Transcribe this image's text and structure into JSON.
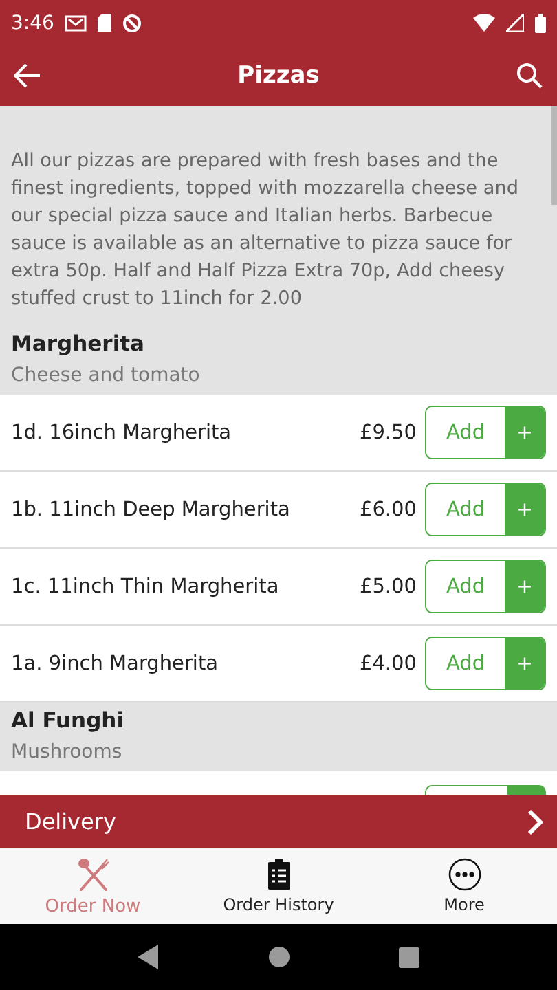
{
  "status_bar": {
    "time": "3:46"
  },
  "app_bar": {
    "title": "Pizzas"
  },
  "intro": "All our pizzas are prepared with fresh bases and the finest ingredients, topped with mozzarella cheese and our special pizza sauce and Italian herbs. Barbecue sauce is available as an alternative to pizza sauce for extra 50p. Half and Half Pizza Extra 70p, Add cheesy stuffed crust to 11inch for 2.00",
  "categories": [
    {
      "name": "Margherita",
      "description": "Cheese and tomato",
      "items": [
        {
          "name": "1d. 16inch Margherita",
          "price": "£9.50",
          "button": "Add",
          "plus": "+"
        },
        {
          "name": "1b. 11inch Deep Margherita",
          "price": "£6.00",
          "button": "Add",
          "plus": "+"
        },
        {
          "name": "1c. 11inch Thin Margherita",
          "price": "£5.00",
          "button": "Add",
          "plus": "+"
        },
        {
          "name": "1a. 9inch Margherita",
          "price": "£4.00",
          "button": "Add",
          "plus": "+"
        }
      ]
    },
    {
      "name": "Al Funghi",
      "description": "Mushrooms"
    }
  ],
  "delivery_bar": {
    "label": "Delivery"
  },
  "bottom_nav": [
    {
      "label": "Order Now",
      "kind": "cutlery",
      "selected": true
    },
    {
      "label": "Order History",
      "kind": "clipboard",
      "selected": false
    },
    {
      "label": "More",
      "kind": "more",
      "selected": false
    }
  ]
}
